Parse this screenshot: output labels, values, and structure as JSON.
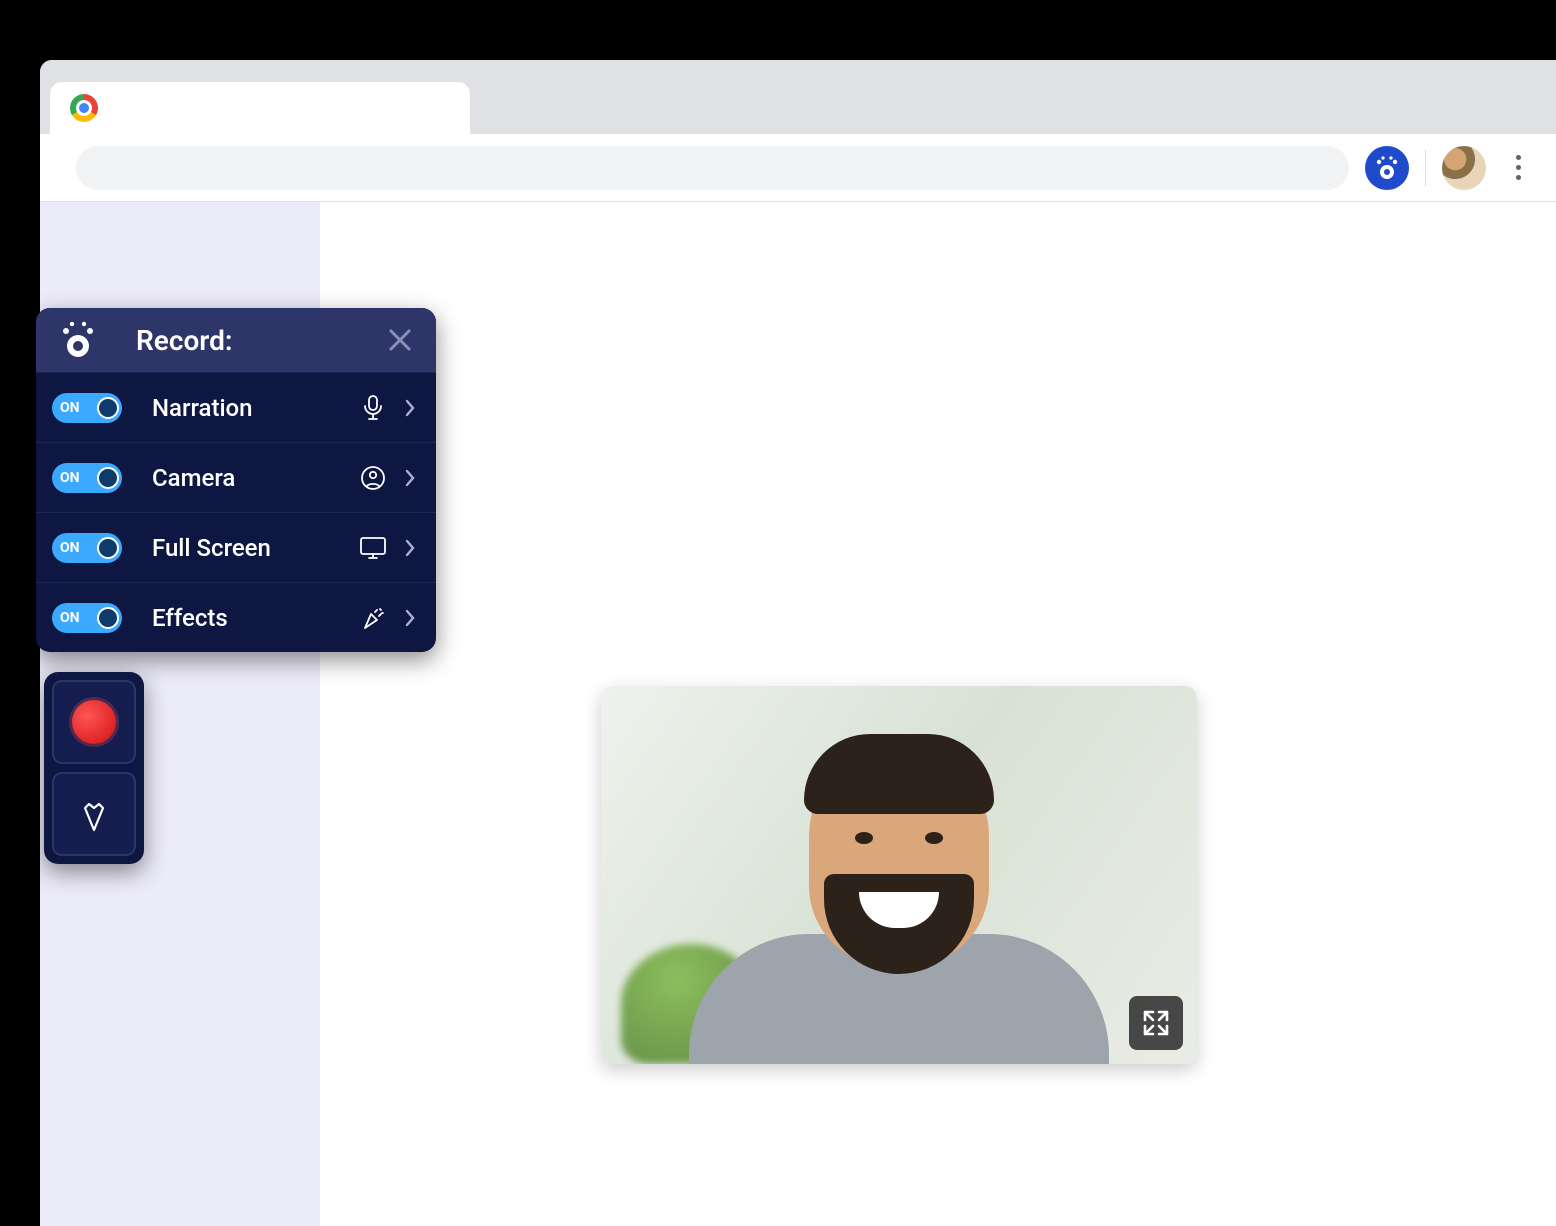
{
  "panel": {
    "title": "Record:",
    "rows": [
      {
        "label": "Narration",
        "toggle": "ON",
        "icon": "microphone-icon"
      },
      {
        "label": "Camera",
        "toggle": "ON",
        "icon": "person-circle-icon"
      },
      {
        "label": "Full Screen",
        "toggle": "ON",
        "icon": "monitor-icon"
      },
      {
        "label": "Effects",
        "toggle": "ON",
        "icon": "confetti-icon"
      }
    ]
  },
  "colors": {
    "panel_bg": "#0e1642",
    "panel_header_bg": "#2e3568",
    "toggle_on": "#3aa9ff",
    "record_red": "#e41818",
    "ext_blue": "#1f4acc"
  }
}
